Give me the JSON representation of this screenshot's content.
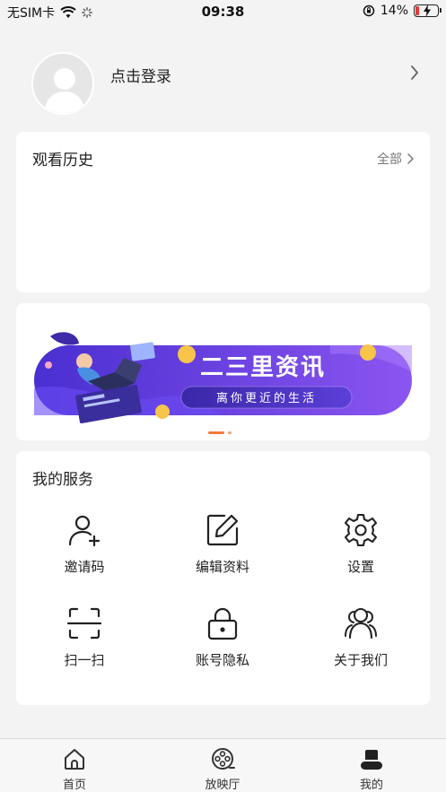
{
  "status_bar": {
    "carrier": "无SIM卡",
    "time": "09:38",
    "battery_percent": "14%",
    "battery_level": 0.14,
    "battery_color": "#e53935"
  },
  "profile": {
    "login_label": "点击登录",
    "avatar_icon": "default-avatar-icon"
  },
  "history": {
    "title": "观看历史",
    "all_label": "全部"
  },
  "banner": {
    "title": "二三里资讯",
    "subtitle": "离你更近的生活",
    "colors": {
      "bg_start": "#4a2fd1",
      "bg_end": "#8b55f0",
      "accent": "#f07b3c"
    }
  },
  "services": {
    "title": "我的服务",
    "items": [
      {
        "label": "邀请码",
        "icon": "add-user-icon"
      },
      {
        "label": "编辑资料",
        "icon": "edit-icon"
      },
      {
        "label": "设置",
        "icon": "gear-icon"
      },
      {
        "label": "扫一扫",
        "icon": "scan-icon"
      },
      {
        "label": "账号隐私",
        "icon": "lock-icon"
      },
      {
        "label": "关于我们",
        "icon": "users-icon"
      }
    ]
  },
  "tabbar": {
    "tabs": [
      {
        "label": "首页",
        "icon": "home-icon"
      },
      {
        "label": "放映厅",
        "icon": "film-reel-icon"
      },
      {
        "label": "我的",
        "icon": "user-icon",
        "active": true
      }
    ]
  }
}
